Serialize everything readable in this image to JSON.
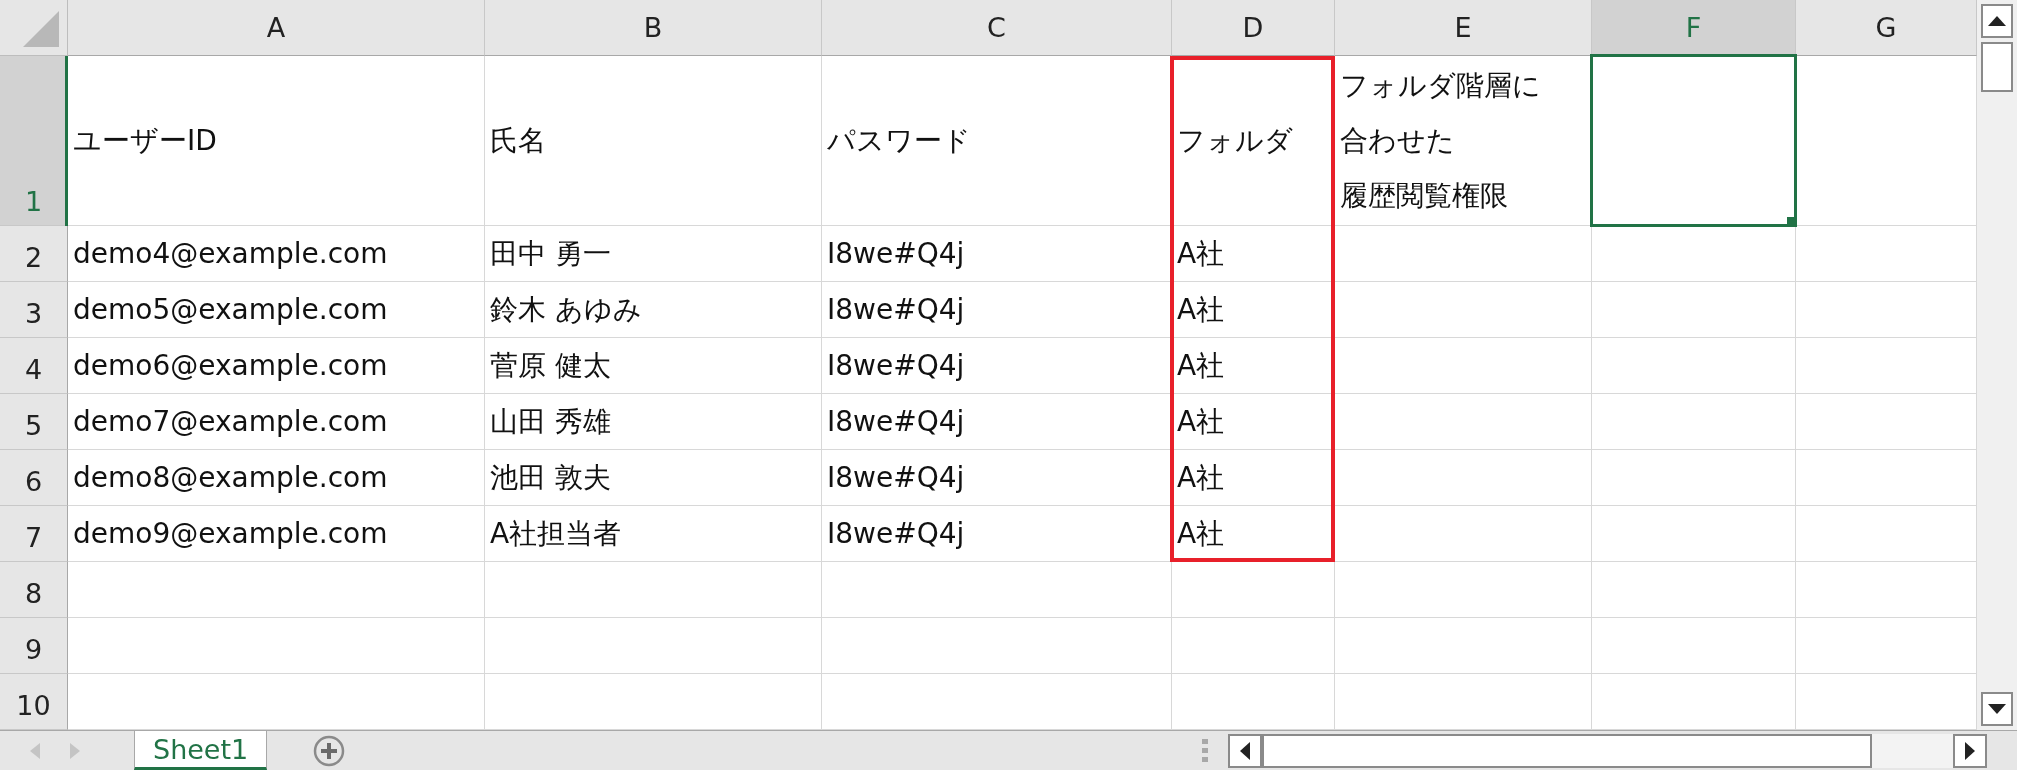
{
  "columns": [
    {
      "letter": "A",
      "selected": false,
      "framed": false
    },
    {
      "letter": "B",
      "selected": false,
      "framed": false
    },
    {
      "letter": "C",
      "selected": false,
      "framed": false
    },
    {
      "letter": "D",
      "selected": false,
      "framed": true
    },
    {
      "letter": "E",
      "selected": false,
      "framed": false
    },
    {
      "letter": "F",
      "selected": true,
      "framed": false
    },
    {
      "letter": "G",
      "selected": false,
      "framed": false
    }
  ],
  "rows": [
    {
      "number": "1",
      "selected": true,
      "in_frame": true,
      "cells": [
        "ユーザーID",
        "氏名",
        "パスワード",
        "フォルダ",
        [
          "フォルダ階層に",
          "合わせた",
          "履歴閲覧権限"
        ]
      ]
    },
    {
      "number": "2",
      "selected": false,
      "in_frame": true,
      "cells": [
        "demo4@example.com",
        "田中 勇一",
        "I8we#Q4j",
        "A社"
      ]
    },
    {
      "number": "3",
      "selected": false,
      "in_frame": true,
      "cells": [
        "demo5@example.com",
        "鈴木 あゆみ",
        "I8we#Q4j",
        "A社"
      ]
    },
    {
      "number": "4",
      "selected": false,
      "in_frame": true,
      "cells": [
        "demo6@example.com",
        "菅原 健太",
        "I8we#Q4j",
        "A社"
      ]
    },
    {
      "number": "5",
      "selected": false,
      "in_frame": true,
      "cells": [
        "demo7@example.com",
        "山田 秀雄",
        "I8we#Q4j",
        "A社"
      ]
    },
    {
      "number": "6",
      "selected": false,
      "in_frame": true,
      "cells": [
        "demo8@example.com",
        "池田 敦夫",
        "I8we#Q4j",
        "A社"
      ]
    },
    {
      "number": "7",
      "selected": false,
      "in_frame": true,
      "cells": [
        "demo9@example.com",
        "A社担当者",
        "I8we#Q4j",
        "A社"
      ]
    },
    {
      "number": "8",
      "selected": false,
      "in_frame": false
    },
    {
      "number": "9",
      "selected": false,
      "in_frame": false
    },
    {
      "number": "10",
      "selected": false,
      "in_frame": false
    }
  ],
  "sheet_tabs": [
    {
      "label": "Sheet1",
      "selected": true
    }
  ]
}
